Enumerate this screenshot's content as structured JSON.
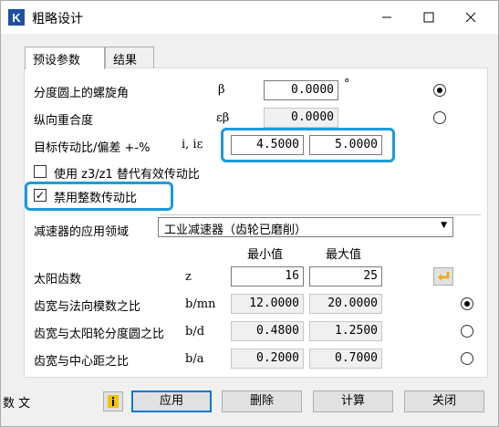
{
  "window": {
    "title": "粗略设计",
    "app_icon_letter": "K"
  },
  "tabs": [
    {
      "label": "预设参数"
    },
    {
      "label": "结果"
    }
  ],
  "rows": {
    "helix": {
      "label": "分度圆上的螺旋角",
      "symbol": "β",
      "value": "0.0000",
      "unit": "°",
      "selected": true
    },
    "overlap": {
      "label": "纵向重合度",
      "symbol": "εβ",
      "value": "0.0000",
      "selected": false
    },
    "ratio": {
      "label": "目标传动比/偏差 +-%",
      "symbol": "i, iε",
      "value1": "4.5000",
      "value2": "5.0000"
    },
    "use_z3z1": {
      "label": "使用 z3/z1 替代有效传动比",
      "checked": false
    },
    "disable_integer": {
      "label": "禁用整数传动比",
      "checked": true
    }
  },
  "application": {
    "label": "减速器的应用领域",
    "value": "工业减速器（齿轮已磨削）"
  },
  "headers": {
    "min": "最小值",
    "max": "最大值"
  },
  "params": [
    {
      "label": "太阳齿数",
      "symbol": "z",
      "min": "16",
      "max": "25",
      "readonly": false
    },
    {
      "label": "齿宽与法向模数之比",
      "symbol": "b/mn",
      "min": "12.0000",
      "max": "20.0000",
      "readonly": true,
      "selected": true
    },
    {
      "label": "齿宽与太阳轮分度圆之比",
      "symbol": "b/d",
      "min": "0.4800",
      "max": "1.2500",
      "readonly": true,
      "selected": false
    },
    {
      "label": "齿宽与中心距之比",
      "symbol": "b/a",
      "min": "0.2000",
      "max": "0.7000",
      "readonly": true,
      "selected": false
    }
  ],
  "buttons": {
    "apply": "应用",
    "delete": "删除",
    "calculate": "计算",
    "close": "关闭"
  },
  "side_text": "数 文",
  "colors": {
    "highlight": "#1a9bd9",
    "title_icon": "#1e4fa0",
    "accent_arrow": "#f2a900"
  }
}
